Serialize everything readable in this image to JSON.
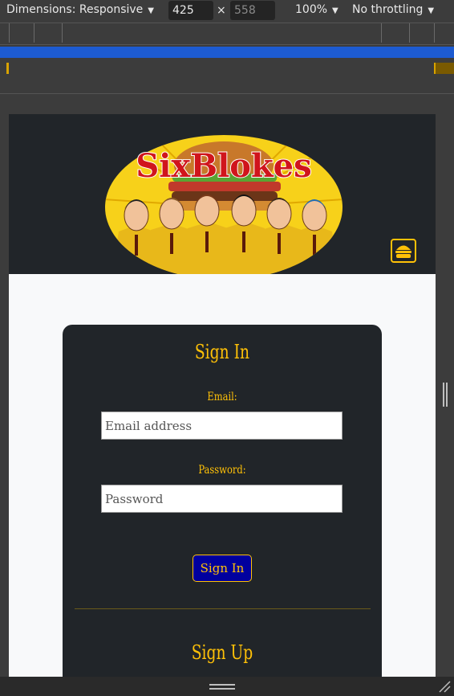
{
  "toolbar": {
    "dimensions_label": "Dimensions: Responsive",
    "width_value": "425",
    "height_placeholder": "558",
    "zoom_label": "100%",
    "throttling_label": "No throttling",
    "separator": "×"
  },
  "site": {
    "logo_text": "SixBlokes",
    "menu_icon": "burger-icon"
  },
  "signin": {
    "title": "Sign In",
    "email_label": "Email:",
    "email_placeholder": "Email address",
    "password_label": "Password:",
    "password_placeholder": "Password",
    "submit_label": "Sign In"
  },
  "signup": {
    "title": "Sign Up"
  },
  "colors": {
    "accent": "#ffc107",
    "dark": "#212529",
    "button_bg": "#00009e",
    "devtools_blue": "#1d5bd1"
  }
}
